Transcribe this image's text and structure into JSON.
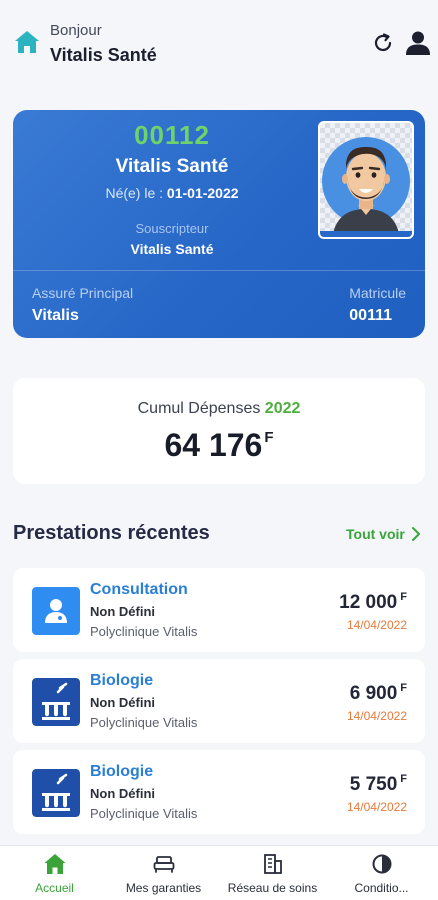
{
  "header": {
    "greeting": "Bonjour",
    "user_name": "Vitalis Santé"
  },
  "card": {
    "number": "00112",
    "name": "Vitalis Santé",
    "birth_label": "Né(e) le :",
    "birth_date": "01-01-2022",
    "subscriber_label": "Souscripteur",
    "subscriber_value": "Vitalis Santé",
    "insured_label": "Assuré Principal",
    "insured_value": "Vitalis",
    "matricule_label": "Matricule",
    "matricule_value": "00111"
  },
  "cumul": {
    "label": "Cumul Dépenses",
    "year": "2022",
    "amount": "64 176",
    "currency": "F"
  },
  "recent": {
    "title": "Prestations récentes",
    "see_all": "Tout voir",
    "items": [
      {
        "icon": "consultation-icon",
        "title": "Consultation",
        "subtitle": "Non Défini",
        "location": "Polyclinique Vitalis",
        "amount": "12 000",
        "currency": "F",
        "date": "14/04/2022"
      },
      {
        "icon": "biologie-icon",
        "title": "Biologie",
        "subtitle": "Non Défini",
        "location": "Polyclinique Vitalis",
        "amount": "6 900",
        "currency": "F",
        "date": "14/04/2022"
      },
      {
        "icon": "biologie-icon",
        "title": "Biologie",
        "subtitle": "Non Défini",
        "location": "Polyclinique Vitalis",
        "amount": "5 750",
        "currency": "F",
        "date": "14/04/2022"
      }
    ]
  },
  "tabs": [
    {
      "label": "Accueil",
      "icon": "home-icon",
      "active": true
    },
    {
      "label": "Mes garanties",
      "icon": "bed-icon",
      "active": false
    },
    {
      "label": "Réseau de soins",
      "icon": "building-icon",
      "active": false
    },
    {
      "label": "Conditio...",
      "icon": "contrast-icon",
      "active": false
    }
  ],
  "colors": {
    "primary_blue": "#2767c7",
    "accent_green": "#4caf3c",
    "link_blue": "#2a7fd4",
    "date_orange": "#e57a3a"
  }
}
